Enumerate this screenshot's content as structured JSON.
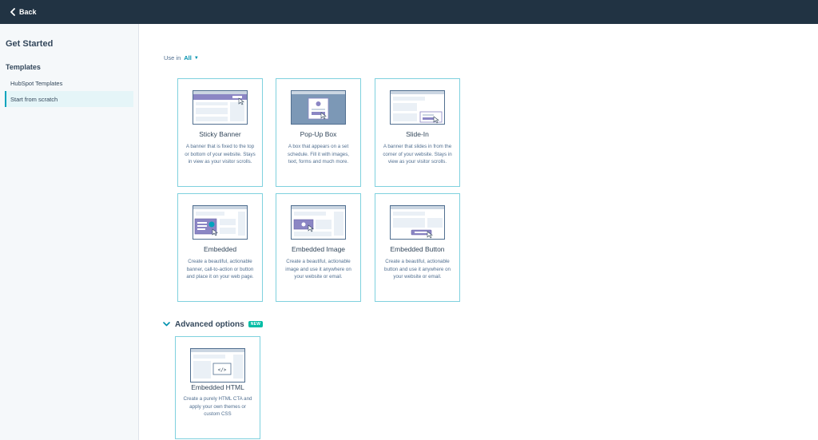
{
  "topbar": {
    "back_label": "Back"
  },
  "sidebar": {
    "title": "Get Started",
    "section": "Templates",
    "items": [
      {
        "label": "HubSpot Templates",
        "active": false
      },
      {
        "label": "Start from scratch",
        "active": true
      }
    ]
  },
  "filter": {
    "label": "Use in",
    "value": "All"
  },
  "cards": [
    {
      "title": "Sticky Banner",
      "description": "A banner that is fixed to the top or bottom of your website. Stays in view as your visitor scrolls."
    },
    {
      "title": "Pop-Up Box",
      "description": "A box that appears on a set schedule. Fill it with images, text, forms and much more."
    },
    {
      "title": "Slide-In",
      "description": "A banner that slides in from the corner of your website. Stays in view as your visitor scrolls."
    },
    {
      "title": "Embedded",
      "description": "Create a beautiful, actionable banner, call-to-action or button and place it on your web page."
    },
    {
      "title": "Embedded Image",
      "description": "Create a beautiful, actionable image and use it anywhere on your website or email."
    },
    {
      "title": "Embedded Button",
      "description": "Create a beautiful, actionable button and use it anywhere on your website or email."
    }
  ],
  "advanced": {
    "label": "Advanced options",
    "badge": "NEW",
    "cards": [
      {
        "title": "Embedded HTML",
        "description": "Create a purely HTML CTA and apply your own themes or custom CSS"
      }
    ]
  },
  "colors": {
    "topbar": "#213343",
    "accent": "#00a4bd",
    "card_border": "#7fd1de",
    "illustration": "#8b86c4",
    "badge": "#00bda5"
  }
}
